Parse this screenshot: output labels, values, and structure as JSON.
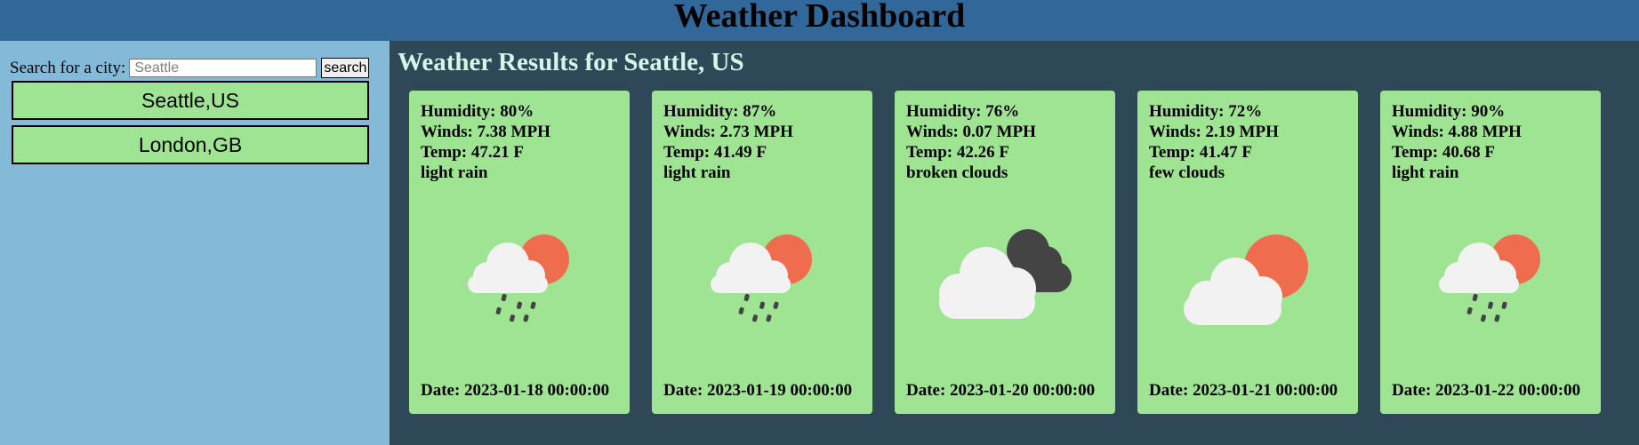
{
  "header": {
    "title": "Weather Dashboard"
  },
  "sidebar": {
    "search_label": "Search for a city:",
    "search_placeholder": "Seattle",
    "search_value": "",
    "search_button": "search",
    "history": [
      "Seattle,US",
      "London,GB"
    ]
  },
  "main": {
    "title": "Weather Results for Seattle, US",
    "cards": [
      {
        "humidity": "Humidity: 80%",
        "wind": "Winds: 7.38 MPH",
        "temp": "Temp: 47.21 F",
        "desc": "light rain",
        "icon": "rain-sun-icon",
        "date": "Date: 2023-01-18 00:00:00"
      },
      {
        "humidity": "Humidity: 87%",
        "wind": "Winds: 2.73 MPH",
        "temp": "Temp: 41.49 F",
        "desc": "light rain",
        "icon": "rain-sun-icon",
        "date": "Date: 2023-01-19 00:00:00"
      },
      {
        "humidity": "Humidity: 76%",
        "wind": "Winds: 0.07 MPH",
        "temp": "Temp: 42.26 F",
        "desc": "broken clouds",
        "icon": "broken-clouds-icon",
        "date": "Date: 2023-01-20 00:00:00"
      },
      {
        "humidity": "Humidity: 72%",
        "wind": "Winds: 2.19 MPH",
        "temp": "Temp: 41.47 F",
        "desc": "few clouds",
        "icon": "few-clouds-icon",
        "date": "Date: 2023-01-21 00:00:00"
      },
      {
        "humidity": "Humidity: 90%",
        "wind": "Winds: 4.88 MPH",
        "temp": "Temp: 40.68 F",
        "desc": "light rain",
        "icon": "rain-sun-icon",
        "date": "Date: 2023-01-22 00:00:00"
      }
    ]
  },
  "colors": {
    "header_bg": "#316799",
    "sidebar_bg": "#84b9d7",
    "main_bg": "#2f4858",
    "card_bg": "#9ee493",
    "title_text": "#d4f5e9",
    "sun": "#ef6c4e",
    "cloud": "#f2f2f2",
    "dark_cloud": "#444444"
  }
}
